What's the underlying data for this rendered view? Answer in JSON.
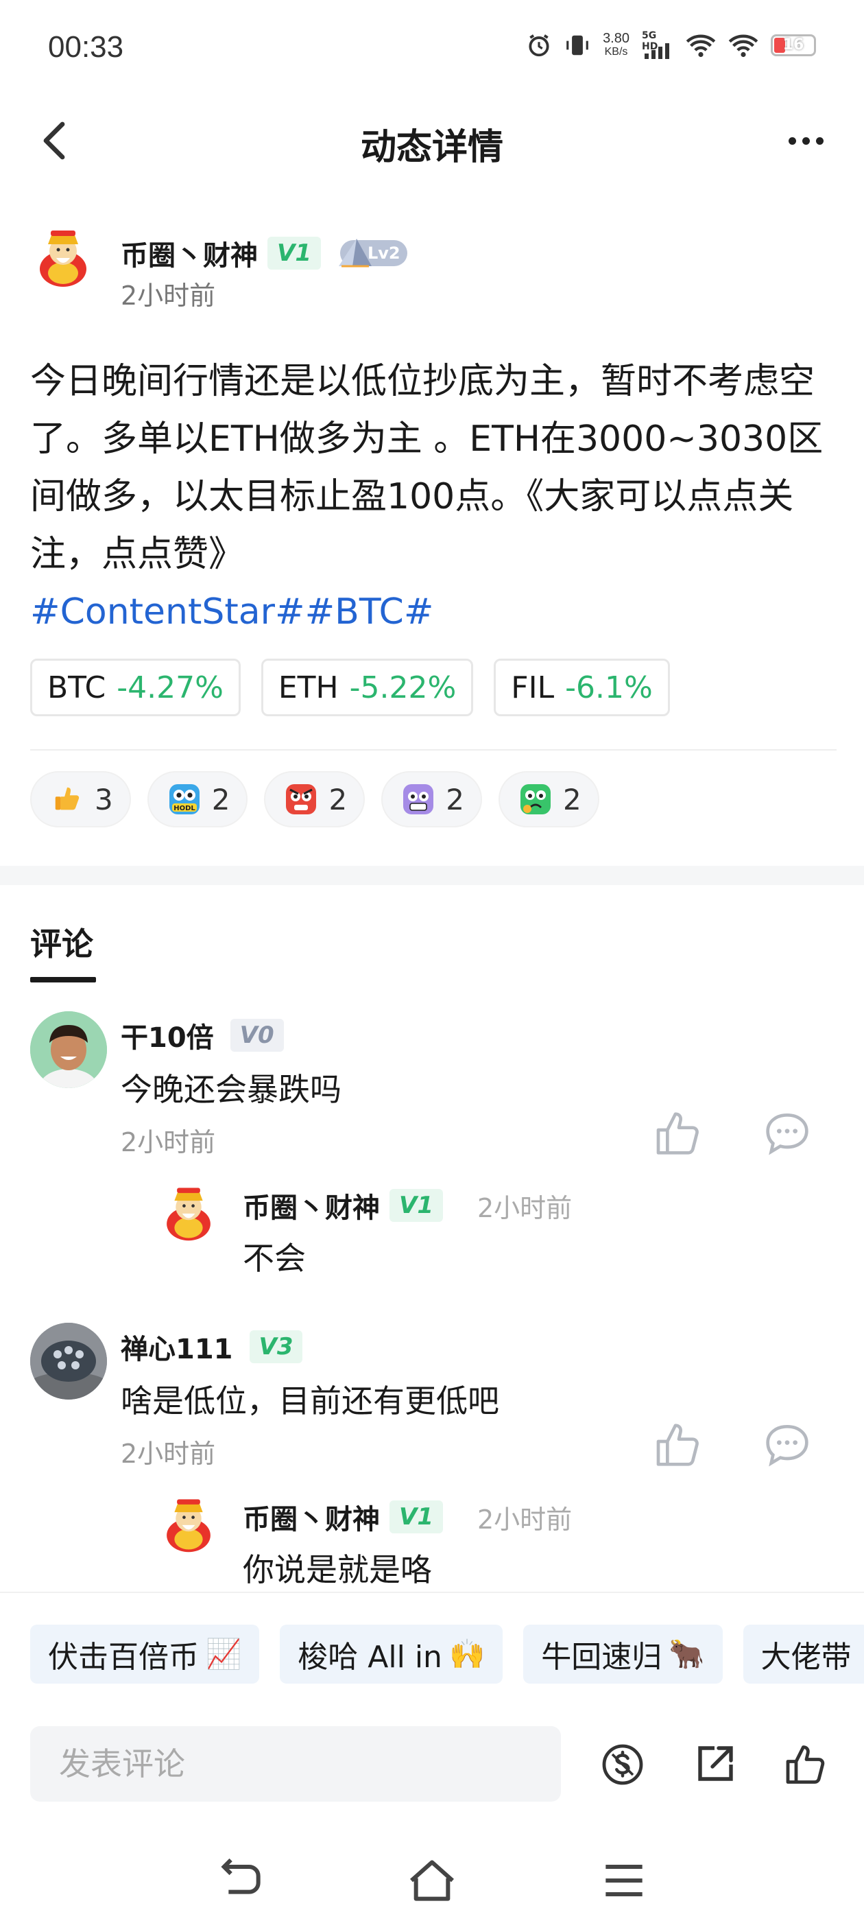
{
  "status_bar": {
    "time": "00:33",
    "net_speed_value": "3.80",
    "net_speed_unit": "KB/s",
    "network": "5G HD",
    "battery": "16"
  },
  "header": {
    "title": "动态详情"
  },
  "author": {
    "name": "币圈丶财神",
    "verify_badge": "V1",
    "level_badge": "Lv2",
    "time": "2小时前"
  },
  "post": {
    "text": "今日晚间行情还是以低位抄底为主，暂时不考虑空了。多单以ETH做多为主 。ETH在3000~3030区间做多，以太目标止盈100点。《大家可以点点关注，点点赞》",
    "hashtags": "#ContentStar##BTC#"
  },
  "coins": [
    {
      "symbol": "BTC",
      "change": "-4.27%"
    },
    {
      "symbol": "ETH",
      "change": "-5.22%"
    },
    {
      "symbol": "FIL",
      "change": "-6.1%"
    }
  ],
  "reactions": [
    {
      "icon": "thumbs-up-emoji",
      "count": "3"
    },
    {
      "icon": "hodl-emoji",
      "count": "2"
    },
    {
      "icon": "angry-emoji",
      "count": "2"
    },
    {
      "icon": "scared-emoji",
      "count": "2"
    },
    {
      "icon": "sick-emoji",
      "count": "2"
    }
  ],
  "comments_tab": "评论",
  "comments": [
    {
      "name": "干10倍",
      "badge": "V0",
      "text": "今晚还会暴跌吗",
      "time": "2小时前",
      "reply": {
        "name": "币圈丶财神",
        "badge": "V1",
        "time": "2小时前",
        "text": "不会"
      }
    },
    {
      "name": "禅心111",
      "badge": "V3",
      "text": "啥是低位，目前还有更低吧",
      "time": "2小时前",
      "reply": {
        "name": "币圈丶财神",
        "badge": "V1",
        "time": "2小时前",
        "text": "你说是就是咯"
      }
    }
  ],
  "quick_replies": [
    {
      "label": "伏击百倍币",
      "emoji": "📈"
    },
    {
      "label": "梭哈 All in",
      "emoji": "🙌"
    },
    {
      "label": "牛回速归",
      "emoji": "🐂"
    },
    {
      "label": "大佬带",
      "emoji": ""
    }
  ],
  "comment_input": {
    "placeholder": "发表评论"
  },
  "colors": {
    "accent_green": "#2bb56e",
    "hashtag_blue": "#2364d2",
    "text": "#1a1a1a"
  }
}
